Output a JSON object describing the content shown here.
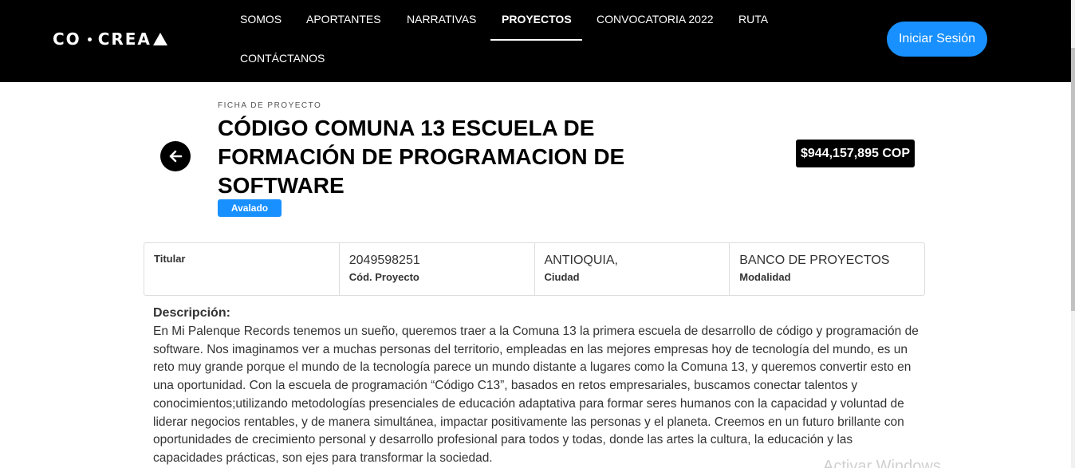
{
  "header": {
    "logo": {
      "left": "CO",
      "right": "CREA"
    },
    "nav": [
      {
        "label": "SOMOS",
        "active": false
      },
      {
        "label": "APORTANTES",
        "active": false
      },
      {
        "label": "NARRATIVAS",
        "active": false
      },
      {
        "label": "PROYECTOS",
        "active": true
      },
      {
        "label": "CONVOCATORIA 2022",
        "active": false
      },
      {
        "label": "RUTA",
        "active": false
      },
      {
        "label": "CONTÁCTANOS",
        "active": false
      }
    ],
    "login_label": "Iniciar Sesión"
  },
  "project": {
    "eyebrow": "FICHA DE PROYECTO",
    "title": "CÓDIGO COMUNA 13 ESCUELA DE FORMACIÓN DE PROGRAMACION DE SOFTWARE",
    "status": "Avalado",
    "amount": "$944,157,895 COP",
    "back_icon": "arrow-left-icon"
  },
  "details": {
    "titular_label": "Titular",
    "code_value": "2049598251",
    "code_label": "Cód. Proyecto",
    "city_value": "ANTIOQUIA,",
    "city_label": "Ciudad",
    "modality_value": "BANCO DE PROYECTOS",
    "modality_label": "Modalidad"
  },
  "description": {
    "heading": "Descripción:",
    "text": "En Mi Palenque Records tenemos un sueño, queremos traer a la Comuna 13 la primera escuela de desarrollo de código y programación de software. Nos imaginamos ver a muchas personas del territorio, empleadas en las mejores empresas hoy de tecnología del mundo, es un reto muy grande porque el mundo de la tecnología parece un mundo distante a lugares como la Comuna 13, y queremos convertir esto en una oportunidad. Con la escuela de programación “Código C13”, basados en retos empresariales, buscamos conectar talentos y conocimientos;utilizando metodologías presenciales de educación adaptativa para formar seres humanos con la capacidad y voluntad de liderar negocios rentables, y de manera simultánea, impactar positivamente las personas y el planeta. Creemos en un futuro brillante con oportunidades de crecimiento personal y desarrollo profesional para todos y todas, donde las artes la cultura, la educación y las capacidades prácticas, son ejes para transformar la sociedad."
  },
  "watermark": "Activar Windows",
  "colors": {
    "accent": "#1890ff",
    "header_bg": "#000000"
  }
}
